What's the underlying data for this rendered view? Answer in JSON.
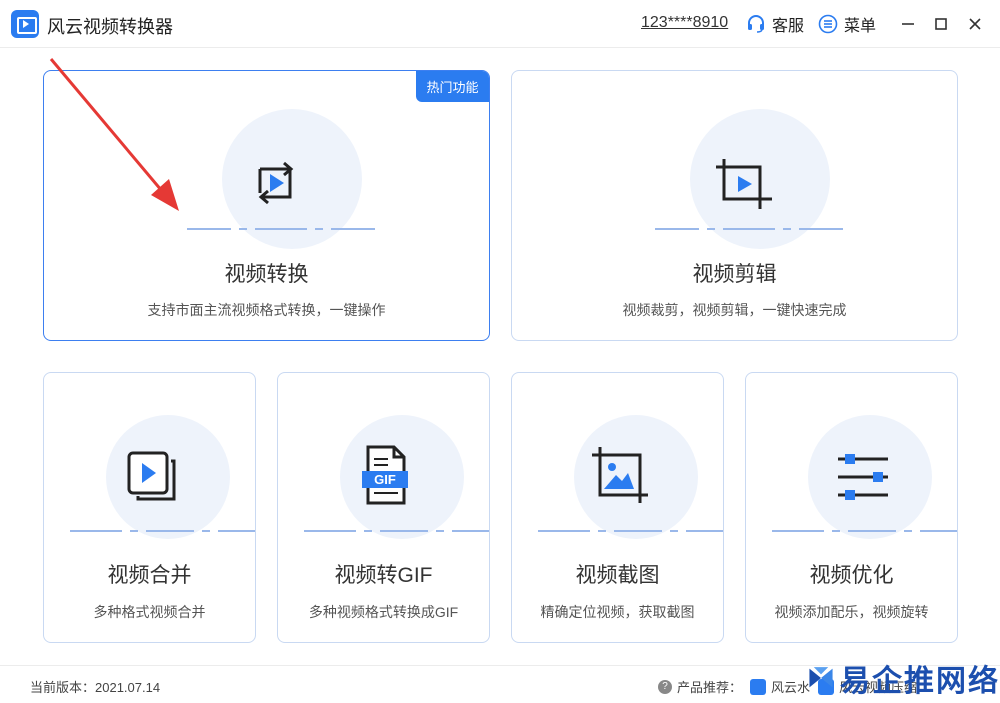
{
  "window": {
    "title": "风云视频转换器",
    "account": "123****8910",
    "service_label": "客服",
    "menu_label": "菜单"
  },
  "cards": {
    "convert": {
      "title": "视频转换",
      "desc": "支持市面主流视频格式转换，一键操作",
      "badge": "热门功能",
      "icon": "convert-icon"
    },
    "edit": {
      "title": "视频剪辑",
      "desc": "视频裁剪，视频剪辑，一键快速完成",
      "icon": "crop-icon"
    },
    "merge": {
      "title": "视频合并",
      "desc": "多种格式视频合并",
      "icon": "merge-icon"
    },
    "gif": {
      "title": "视频转GIF",
      "desc": "多种视频格式转换成GIF",
      "icon_text": "GIF",
      "icon": "gif-file-icon"
    },
    "screenshot": {
      "title": "视频截图",
      "desc": "精确定位视频，获取截图",
      "icon": "screenshot-icon"
    },
    "optimize": {
      "title": "视频优化",
      "desc": "视频添加配乐，视频旋转",
      "icon": "sliders-icon"
    }
  },
  "footer": {
    "version": "当前版本：2021.07.14",
    "recommend_label": "产品推荐：",
    "product_1": "风云水",
    "product_2": "风云视频压缩"
  },
  "watermark": {
    "text": "易企推网络"
  },
  "colors": {
    "accent": "#2b7cf0",
    "card_border": "#c9d9f2",
    "arrow": "#e53935"
  }
}
